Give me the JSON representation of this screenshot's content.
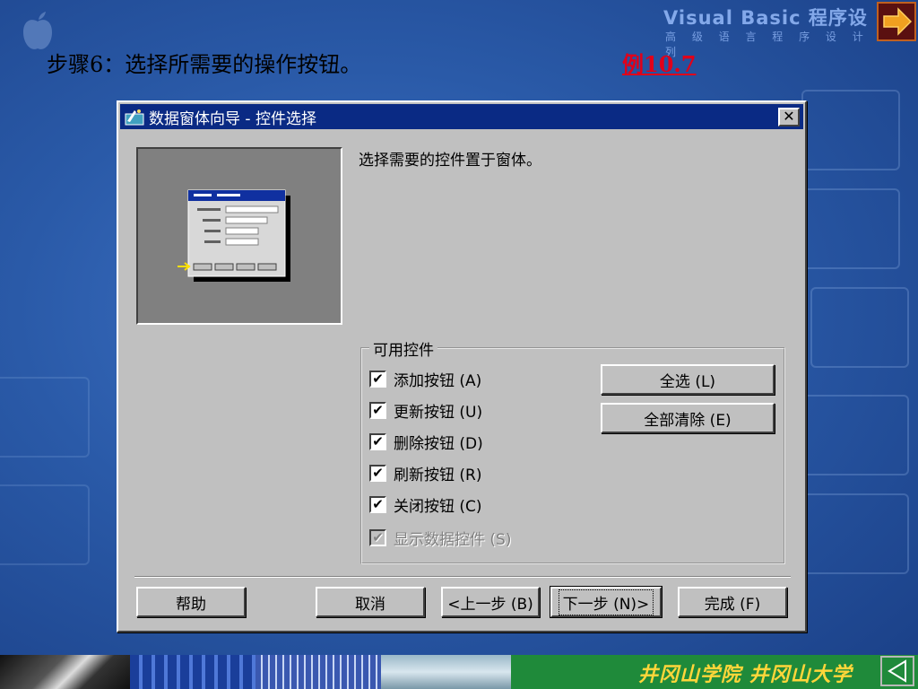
{
  "slide": {
    "title": "步骤6：选择所需要的操作按钮。",
    "example_link": "例10.7",
    "brand_title": "Visual Basic 程序设",
    "brand_subtitle": "高 级 语 言 程 序 设 计 系 列"
  },
  "dialog": {
    "title": "数据窗体向导 - 控件选择",
    "close_label": "✕",
    "instruction": "选择需要的控件置于窗体。",
    "group_label": "可用控件",
    "checkboxes": [
      {
        "label": "添加按钮 (A)",
        "checked": true,
        "enabled": true
      },
      {
        "label": "更新按钮 (U)",
        "checked": true,
        "enabled": true
      },
      {
        "label": "删除按钮 (D)",
        "checked": true,
        "enabled": true
      },
      {
        "label": "刷新按钮 (R)",
        "checked": true,
        "enabled": true
      },
      {
        "label": "关闭按钮 (C)",
        "checked": true,
        "enabled": true
      },
      {
        "label": "显示数据控件 (S)",
        "checked": true,
        "enabled": false
      }
    ],
    "select_all_label": "全选 (L)",
    "clear_all_label": "全部清除 (E)",
    "help_label": "帮助",
    "cancel_label": "取消",
    "back_label": "<上一步 (B)",
    "next_label": "下一步 (N)>",
    "finish_label": "完成 (F)"
  },
  "footer": {
    "school_name": "井冈山学院 井冈山大学"
  },
  "colors": {
    "titlebar": "#0a2a84",
    "dialog_face": "#c0c0c0",
    "link_red": "#e0001a",
    "school_gold": "#ffd63a"
  }
}
